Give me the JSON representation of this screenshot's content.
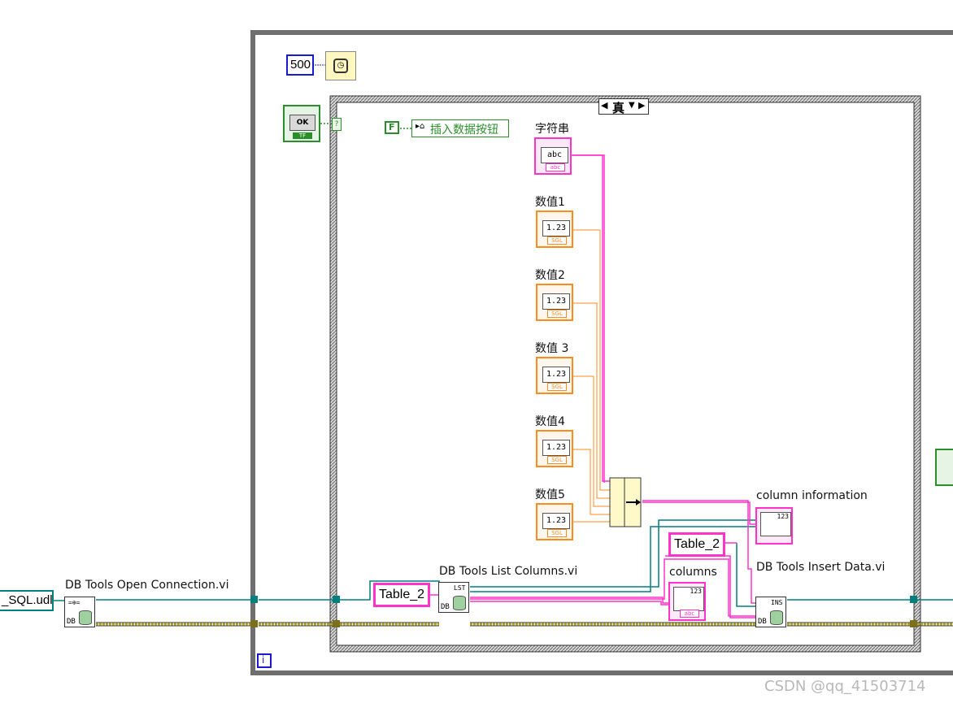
{
  "constants": {
    "wait_ms": "500",
    "udl_path": "_SQL.udl",
    "table_a": "Table_2",
    "table_b": "Table_2",
    "bool_false": "F",
    "iteration_i": "i"
  },
  "case_structure": {
    "selector": "真"
  },
  "labels": {
    "open_connection": "DB Tools Open Connection.vi",
    "list_columns": "DB Tools List Columns.vi",
    "insert_data": "DB Tools Insert Data.vi",
    "column_information": "column information",
    "columns": "columns",
    "string_ctrl": "字符串",
    "num1": "数值1",
    "num2": "数值2",
    "num3": "数值 3",
    "num4": "数值4",
    "num5": "数值5",
    "insert_button_ref": "插入数据按钮"
  },
  "control_text": {
    "ok": "OK",
    "tf": "TF",
    "abc": "abc",
    "num": "1.23",
    "sgl": "SGL",
    "lst": "LST",
    "ins": "INS",
    "db": "DB",
    "arr_num": "123"
  },
  "watermark": "CSDN @qq_41503714",
  "colors": {
    "string_wire": "#ff33cc",
    "number_wire": "#ff8b1a",
    "ref_wire": "#007f7f",
    "error_wire": "#b5a52a",
    "boolean": "#2a8f2a",
    "structure_frame": "#6a6a6a"
  }
}
